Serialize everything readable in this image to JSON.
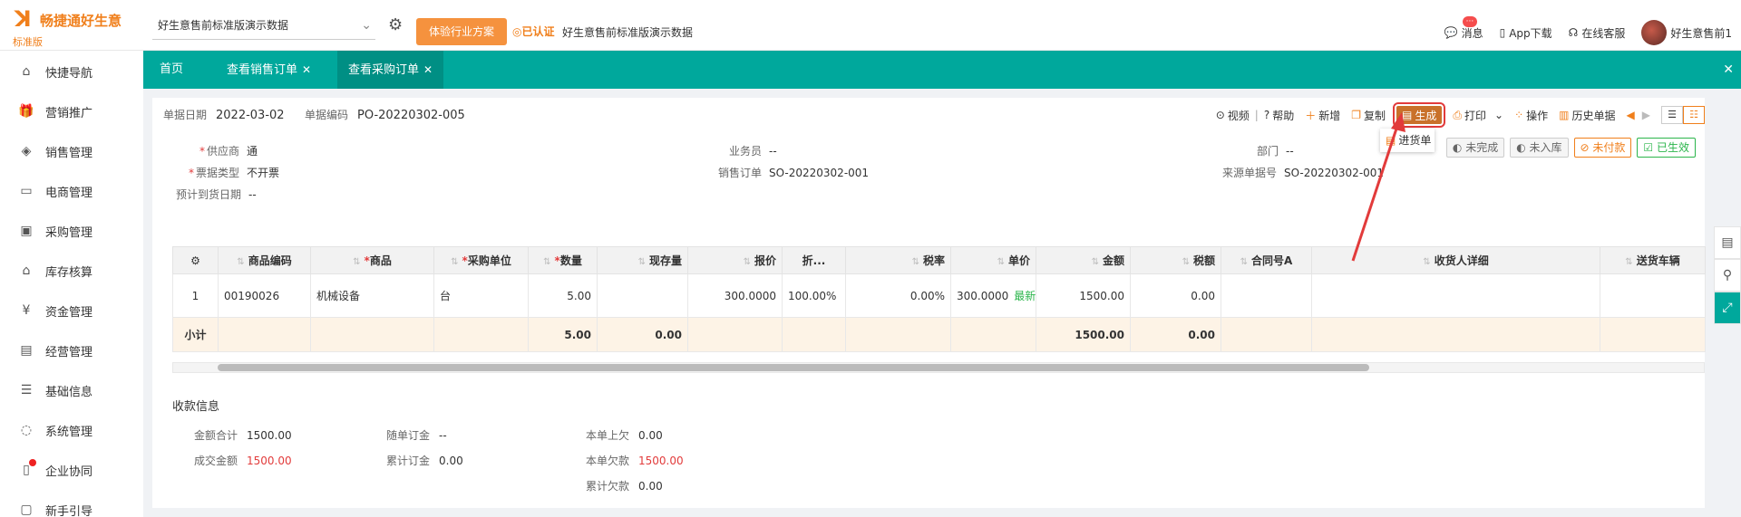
{
  "brand": {
    "name": "畅捷通好生意",
    "edition": "标准版",
    "color": "#f07f1b"
  },
  "topbar": {
    "account": "好生意售前标准版演示数据",
    "trial_button": "体验行业方案",
    "certified": "已认证",
    "org_name": "好生意售前标准版演示数据",
    "messages": "消息",
    "message_badge": "···",
    "app_download": "App下载",
    "online_service": "在线客服",
    "user": "好生意售前1"
  },
  "sidebar": {
    "items": [
      {
        "label": "快捷导航",
        "icon": "home-icon"
      },
      {
        "label": "营销推广",
        "icon": "gift-icon"
      },
      {
        "label": "销售管理",
        "icon": "sales-icon"
      },
      {
        "label": "电商管理",
        "icon": "shop-icon"
      },
      {
        "label": "采购管理",
        "icon": "purchase-icon"
      },
      {
        "label": "库存核算",
        "icon": "warehouse-icon"
      },
      {
        "label": "资金管理",
        "icon": "money-icon"
      },
      {
        "label": "经营管理",
        "icon": "report-icon"
      },
      {
        "label": "基础信息",
        "icon": "info-icon"
      },
      {
        "label": "系统管理",
        "icon": "system-icon"
      },
      {
        "label": "企业协同",
        "icon": "collab-icon"
      },
      {
        "label": "新手引导",
        "icon": "guide-icon"
      }
    ]
  },
  "tabs": [
    {
      "label": "首页"
    },
    {
      "label": "查看销售订单"
    },
    {
      "label": "查看采购订单"
    }
  ],
  "header": {
    "date_label": "单据日期",
    "date_value": "2022-03-02",
    "code_label": "单据编码",
    "code_value": "PO-20220302-005"
  },
  "toolbar": {
    "video": "视频",
    "help": "帮助",
    "new": "新增",
    "copy": "复制",
    "generate": "生成",
    "print": "打印",
    "operate": "操作",
    "history": "历史单据"
  },
  "generate_menu": {
    "item": "进货单"
  },
  "statuses": [
    "未完成",
    "未入库",
    "未付款",
    "已生效"
  ],
  "info": {
    "supplier_label": "供应商",
    "supplier_value": "通",
    "salesman_label": "业务员",
    "salesman_value": "--",
    "dept_label": "部门",
    "dept_value": "--",
    "invoice_label": "票据类型",
    "invoice_value": "不开票",
    "sales_order_label": "销售订单",
    "sales_order_value": "SO-20220302-001",
    "source_label": "来源单据号",
    "source_value": "SO-20220302-001",
    "arrival_label": "预计到货日期",
    "arrival_value": "--"
  },
  "table": {
    "headers": {
      "code": "商品编码",
      "product": "商品",
      "unit": "采购单位",
      "qty": "数量",
      "stock": "现存量",
      "quote": "报价",
      "discount": "折...",
      "tax_rate": "税率",
      "price": "单价",
      "amount": "金额",
      "tax": "税额",
      "contract": "合同号A",
      "receiver": "收货人详细",
      "vehicle": "送货车辆"
    },
    "rows": [
      {
        "no": "1",
        "code": "00190026",
        "product": "机械设备",
        "unit": "台",
        "qty": "5.00",
        "stock": "",
        "quote": "300.0000",
        "discount": "100.00%",
        "tax_rate": "0.00%",
        "price": "300.0000",
        "latest": "最新",
        "amount": "1500.00",
        "tax": "0.00"
      }
    ],
    "subtotal": {
      "label": "小计",
      "qty": "5.00",
      "stock": "0.00",
      "amount": "1500.00",
      "tax": "0.00"
    }
  },
  "payment": {
    "title": "收款信息",
    "total_label": "金额合计",
    "total_value": "1500.00",
    "deal_label": "成交金额",
    "deal_value": "1500.00",
    "deposit_label": "随单订金",
    "deposit_value": "--",
    "acc_deposit_label": "累计订金",
    "acc_deposit_value": "0.00",
    "prev_owed_label": "本单上欠",
    "prev_owed_value": "0.00",
    "owed_label": "本单欠款",
    "owed_value": "1500.00",
    "acc_owed_label": "累计欠款",
    "acc_owed_value": "0.00"
  }
}
